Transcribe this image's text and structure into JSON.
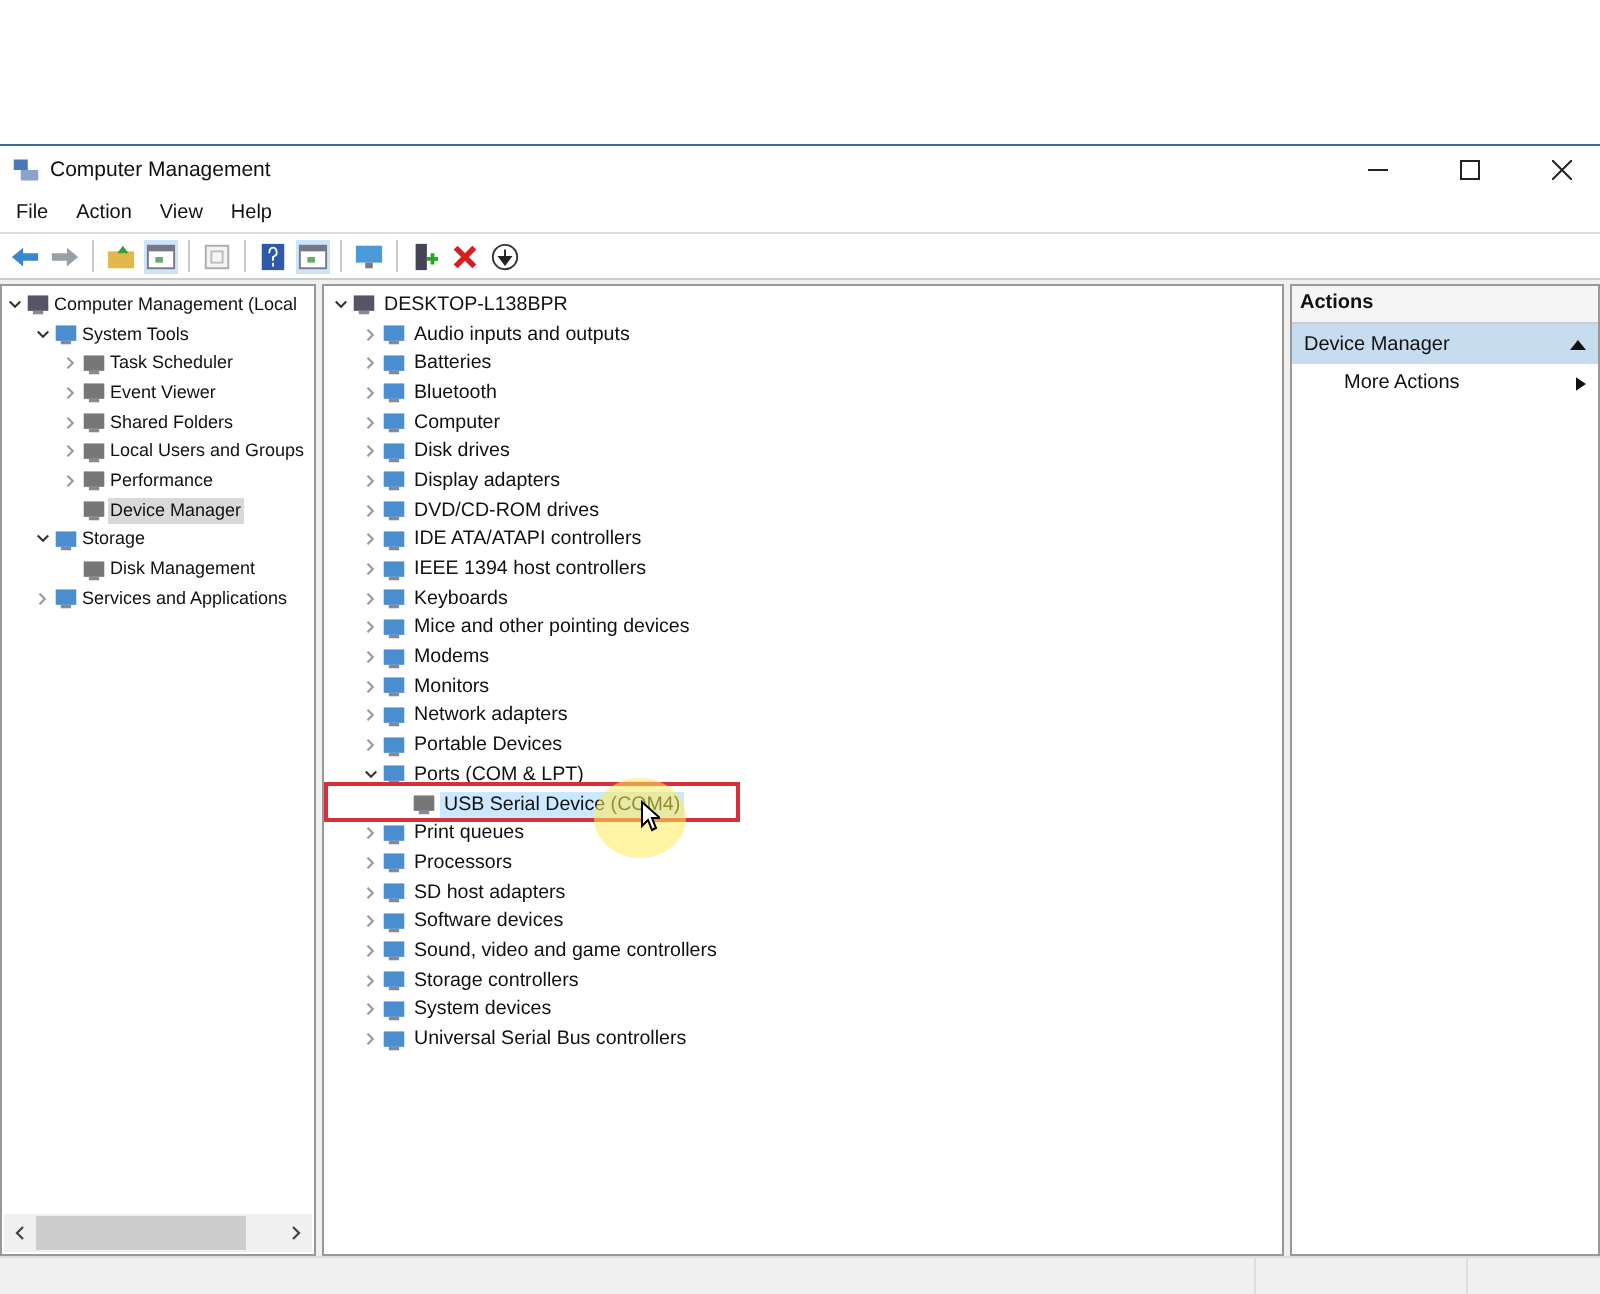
{
  "window": {
    "title": "Computer Management"
  },
  "menu": [
    "File",
    "Action",
    "View",
    "Help"
  ],
  "console_tree": [
    {
      "label": "Computer Management (Local",
      "expanded": true,
      "selected": false,
      "children": [
        {
          "label": "System Tools",
          "expanded": true,
          "selected": false,
          "children": [
            {
              "label": "Task Scheduler",
              "expanded": false,
              "selected": false
            },
            {
              "label": "Event Viewer",
              "expanded": false,
              "selected": false
            },
            {
              "label": "Shared Folders",
              "expanded": false,
              "selected": false
            },
            {
              "label": "Local Users and Groups",
              "expanded": false,
              "selected": false
            },
            {
              "label": "Performance",
              "expanded": false,
              "selected": false
            },
            {
              "label": "Device Manager",
              "selected": true
            }
          ]
        },
        {
          "label": "Storage",
          "expanded": true,
          "selected": false,
          "children": [
            {
              "label": "Disk Management",
              "selected": false
            }
          ]
        },
        {
          "label": "Services and Applications",
          "expanded": false,
          "selected": false
        }
      ]
    }
  ],
  "device_tree": [
    {
      "label": "DESKTOP-L138BPR",
      "expanded": true,
      "selected": false,
      "children": [
        {
          "label": "Audio inputs and outputs",
          "expanded": false,
          "selected": false
        },
        {
          "label": "Batteries",
          "expanded": false,
          "selected": false
        },
        {
          "label": "Bluetooth",
          "expanded": false,
          "selected": false
        },
        {
          "label": "Computer",
          "expanded": false,
          "selected": false
        },
        {
          "label": "Disk drives",
          "expanded": false,
          "selected": false
        },
        {
          "label": "Display adapters",
          "expanded": false,
          "selected": false
        },
        {
          "label": "DVD/CD-ROM drives",
          "expanded": false,
          "selected": false
        },
        {
          "label": "IDE ATA/ATAPI controllers",
          "expanded": false,
          "selected": false
        },
        {
          "label": "IEEE 1394 host controllers",
          "expanded": false,
          "selected": false
        },
        {
          "label": "Keyboards",
          "expanded": false,
          "selected": false
        },
        {
          "label": "Mice and other pointing devices",
          "expanded": false,
          "selected": false
        },
        {
          "label": "Modems",
          "expanded": false,
          "selected": false
        },
        {
          "label": "Monitors",
          "expanded": false,
          "selected": false
        },
        {
          "label": "Network adapters",
          "expanded": false,
          "selected": false
        },
        {
          "label": "Portable Devices",
          "expanded": false,
          "selected": false
        },
        {
          "label": "Ports (COM & LPT)",
          "expanded": true,
          "selected": false,
          "children": [
            {
              "label": "USB Serial Device (COM4)",
              "selected": true,
              "annotated": true
            }
          ]
        },
        {
          "label": "Print queues",
          "expanded": false,
          "selected": false
        },
        {
          "label": "Processors",
          "expanded": false,
          "selected": false
        },
        {
          "label": "SD host adapters",
          "expanded": false,
          "selected": false
        },
        {
          "label": "Software devices",
          "expanded": false,
          "selected": false
        },
        {
          "label": "Sound, video and game controllers",
          "expanded": false,
          "selected": false
        },
        {
          "label": "Storage controllers",
          "expanded": false,
          "selected": false
        },
        {
          "label": "System devices",
          "expanded": false,
          "selected": false
        },
        {
          "label": "Universal Serial Bus controllers",
          "expanded": false,
          "selected": false
        }
      ]
    }
  ],
  "actions": {
    "title": "Actions",
    "section": "Device Manager",
    "items": [
      "More Actions"
    ]
  }
}
